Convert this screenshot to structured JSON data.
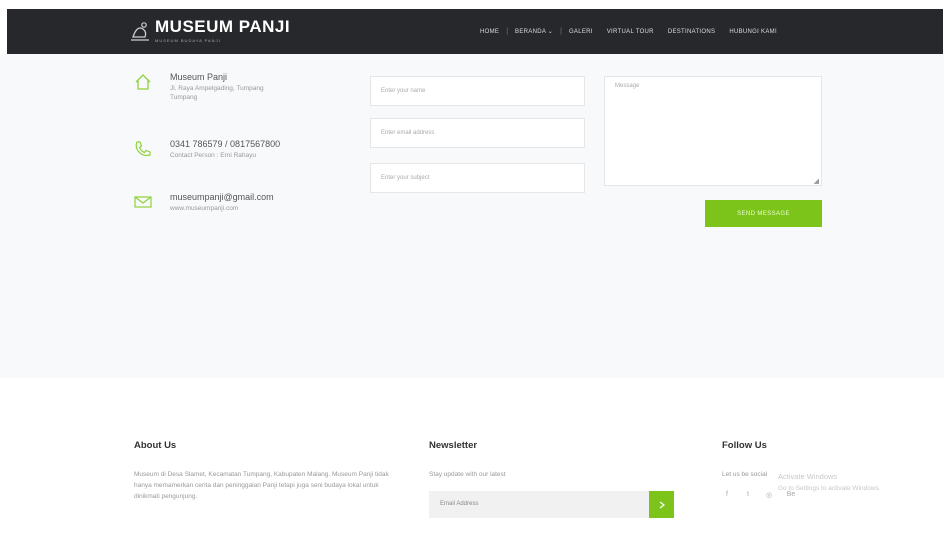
{
  "header": {
    "logo_title": "MUSEUM PANJI",
    "logo_subtitle": "MUSEUM BUDAYA PANJI",
    "nav": [
      {
        "label": "HOME"
      },
      {
        "label": "BERANDA"
      },
      {
        "label": "GALERI"
      },
      {
        "label": "VIRTUAL TOUR"
      },
      {
        "label": "DESTINATIONS"
      },
      {
        "label": "HUBUNGI KAMI"
      }
    ]
  },
  "contact": {
    "address": {
      "title": "Museum Panji",
      "line1": "Jl. Raya Ampelgading, Tumpang",
      "line2": "Tumpang"
    },
    "phone": {
      "title": "0341 786579 / 0817567800",
      "sub": "Contact Person : Erni Rahayu"
    },
    "email": {
      "title": "museumpanji@gmail.com",
      "sub": "www.museumpanji.com"
    }
  },
  "form": {
    "name_placeholder": "Enter your name",
    "email_placeholder": "Enter email address",
    "subject_placeholder": "Enter your subject",
    "message_placeholder": "Message",
    "send_label": "SEND MESSAGE"
  },
  "footer": {
    "about_title": "About Us",
    "about_text": "Museum di Desa Slamet, Kecamatan Tumpang, Kabupaten Malang. Museum Panji tidak hanya memamerkan cerita dan peninggalan Panji tetapi juga seni budaya lokal untuk dinikmati pengunjung.",
    "newsletter_title": "Newsletter",
    "newsletter_text": "Stay update with our latest",
    "newsletter_placeholder": "Email Address",
    "follow_title": "Follow Us",
    "follow_text": "Let us be social",
    "social": [
      {
        "icon": "facebook-icon"
      },
      {
        "icon": "twitter-icon"
      },
      {
        "icon": "dribbble-icon"
      },
      {
        "icon": "behance-icon"
      }
    ],
    "watermark_line1": "Activate Windows",
    "watermark_line2": "Go to Settings to activate Windows."
  },
  "colors": {
    "accent": "#7cc419",
    "nav_bg": "#27282c"
  }
}
